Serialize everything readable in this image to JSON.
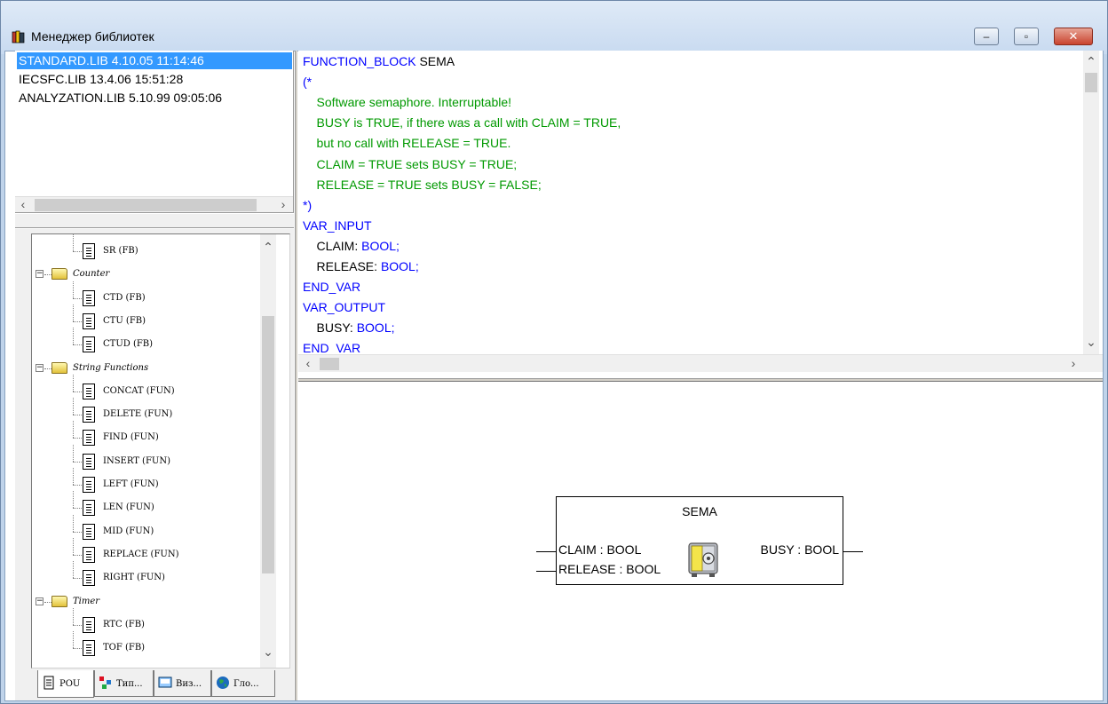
{
  "window": {
    "title": "Менеджер библиотек",
    "controls": {
      "minimize": "–",
      "maximize": "▫",
      "close": "✕"
    }
  },
  "libraries": [
    {
      "label": "STANDARD.LIB 4.10.05 11:14:46",
      "selected": true
    },
    {
      "label": "IECSFC.LIB 13.4.06 15:51:28",
      "selected": false
    },
    {
      "label": "ANALYZATION.LIB 5.10.99 09:05:06",
      "selected": false
    }
  ],
  "tree": {
    "items": [
      {
        "type": "leaf",
        "label": "SR (FB)"
      },
      {
        "type": "folder",
        "label": "Counter"
      },
      {
        "type": "leaf",
        "label": "CTD (FB)"
      },
      {
        "type": "leaf",
        "label": "CTU (FB)"
      },
      {
        "type": "leaf",
        "label": "CTUD (FB)"
      },
      {
        "type": "folder",
        "label": "String Functions"
      },
      {
        "type": "leaf",
        "label": "CONCAT (FUN)"
      },
      {
        "type": "leaf",
        "label": "DELETE (FUN)"
      },
      {
        "type": "leaf",
        "label": "FIND (FUN)"
      },
      {
        "type": "leaf",
        "label": "INSERT (FUN)"
      },
      {
        "type": "leaf",
        "label": "LEFT (FUN)"
      },
      {
        "type": "leaf",
        "label": "LEN (FUN)"
      },
      {
        "type": "leaf",
        "label": "MID (FUN)"
      },
      {
        "type": "leaf",
        "label": "REPLACE (FUN)"
      },
      {
        "type": "leaf",
        "label": "RIGHT (FUN)"
      },
      {
        "type": "folder",
        "label": "Timer"
      },
      {
        "type": "leaf",
        "label": "RTC (FB)"
      },
      {
        "type": "leaf",
        "label": "TOF (FB)"
      }
    ]
  },
  "tabs": [
    {
      "label": "POU",
      "icon": "pou-icon"
    },
    {
      "label": "Тип...",
      "icon": "types-icon"
    },
    {
      "label": "Виз...",
      "icon": "visualization-icon"
    },
    {
      "label": "Гло...",
      "icon": "globals-icon"
    }
  ],
  "code": [
    [
      {
        "t": "FUNCTION_BLOCK ",
        "c": "kw"
      },
      {
        "t": "SEMA",
        "c": ""
      }
    ],
    [
      {
        "t": "(*",
        "c": "kw"
      }
    ],
    [
      {
        "t": "    Software semaphore. Interruptable!",
        "c": "cm"
      }
    ],
    [
      {
        "t": "    BUSY is TRUE, if there was a call with CLAIM = TRUE,",
        "c": "cm"
      }
    ],
    [
      {
        "t": "    but no call with RELEASE = TRUE.",
        "c": "cm"
      }
    ],
    [
      {
        "t": "    CLAIM = TRUE sets BUSY = TRUE;",
        "c": "cm"
      }
    ],
    [
      {
        "t": "    RELEASE = TRUE sets BUSY = FALSE;",
        "c": "cm"
      }
    ],
    [
      {
        "t": "*)",
        "c": "kw"
      }
    ],
    [
      {
        "t": "VAR_INPUT",
        "c": "kw"
      }
    ],
    [
      {
        "t": "    CLAIM: ",
        "c": ""
      },
      {
        "t": "BOOL;",
        "c": "kw"
      }
    ],
    [
      {
        "t": "    RELEASE: ",
        "c": ""
      },
      {
        "t": "BOOL;",
        "c": "kw"
      }
    ],
    [
      {
        "t": "END_VAR",
        "c": "kw"
      }
    ],
    [
      {
        "t": "VAR_OUTPUT",
        "c": "kw"
      }
    ],
    [
      {
        "t": "    BUSY: ",
        "c": ""
      },
      {
        "t": "BOOL;",
        "c": "kw"
      }
    ],
    [
      {
        "t": "END_VAR",
        "c": "kw"
      }
    ]
  ],
  "function_block": {
    "name": "SEMA",
    "inputs": [
      "CLAIM : BOOL",
      "RELEASE : BOOL"
    ],
    "outputs": [
      "BUSY : BOOL"
    ]
  },
  "colors": {
    "keyword": "#0000ff",
    "comment": "#009900",
    "selection": "#3399ff"
  }
}
